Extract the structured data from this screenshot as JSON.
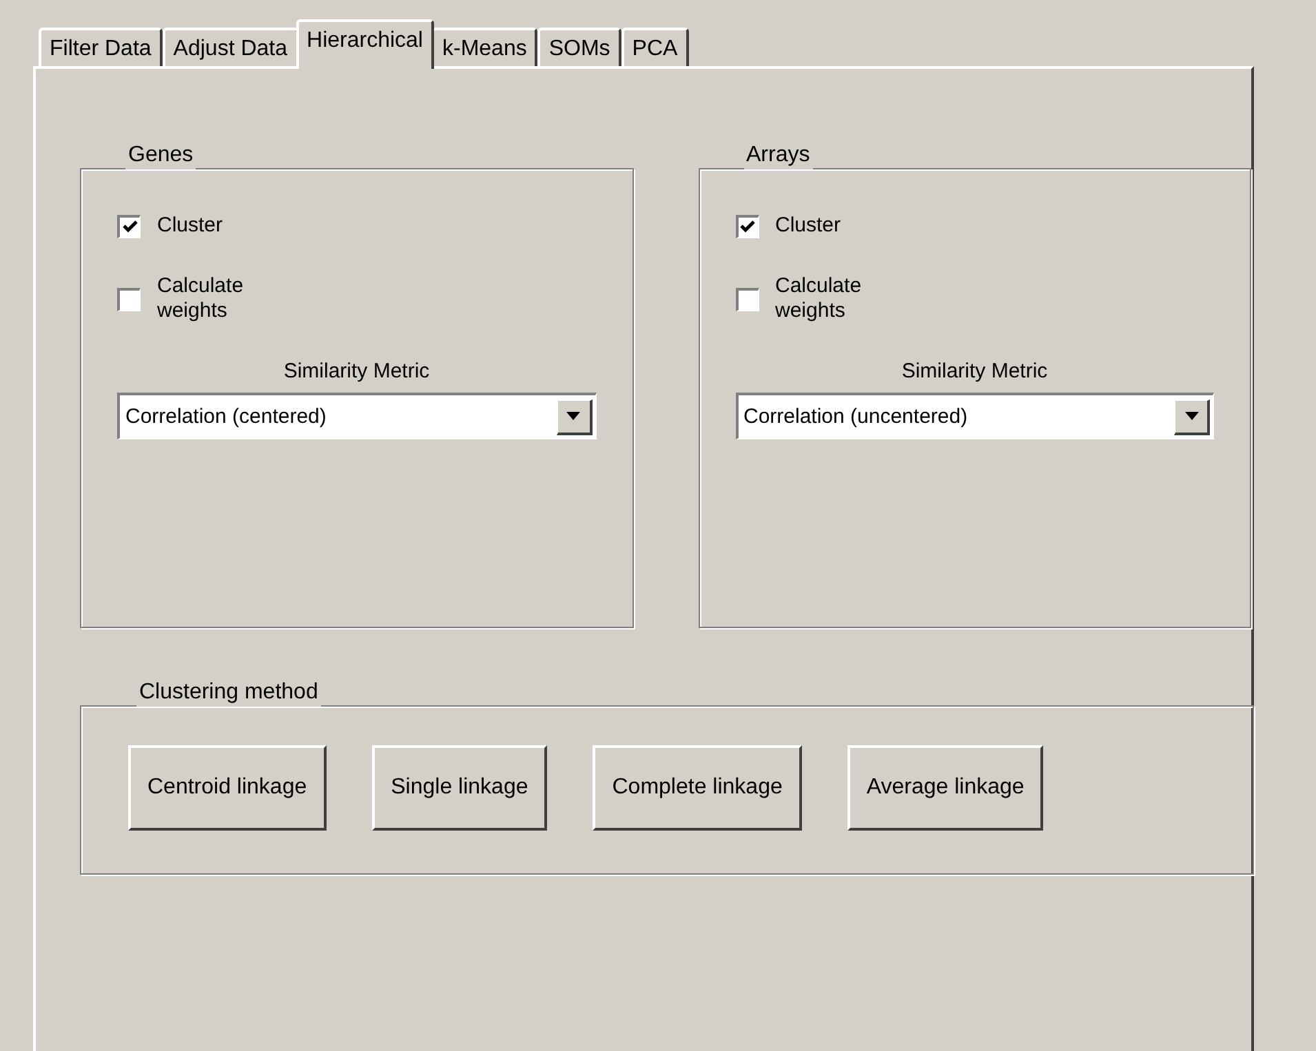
{
  "tabs": [
    {
      "label": "Filter Data",
      "selected": false
    },
    {
      "label": "Adjust Data",
      "selected": false
    },
    {
      "label": "Hierarchical",
      "selected": true
    },
    {
      "label": "k-Means",
      "selected": false
    },
    {
      "label": "SOMs",
      "selected": false
    },
    {
      "label": "PCA",
      "selected": false
    }
  ],
  "groups": [
    {
      "title": "Genes",
      "checkboxes": [
        {
          "label": "Cluster",
          "checked": true
        },
        {
          "label": "Calculate\nweights",
          "checked": false
        }
      ],
      "metric_label": "Similarity Metric",
      "metric_value": "Correlation (centered)"
    },
    {
      "title": "Arrays",
      "checkboxes": [
        {
          "label": "Cluster",
          "checked": true
        },
        {
          "label": "Calculate\nweights",
          "checked": false
        }
      ],
      "metric_label": "Similarity Metric",
      "metric_value": "Correlation (uncentered)"
    }
  ],
  "clustering_method": {
    "title": "Clustering method",
    "buttons": [
      "Centroid linkage",
      "Single linkage",
      "Complete linkage",
      "Average linkage"
    ]
  }
}
